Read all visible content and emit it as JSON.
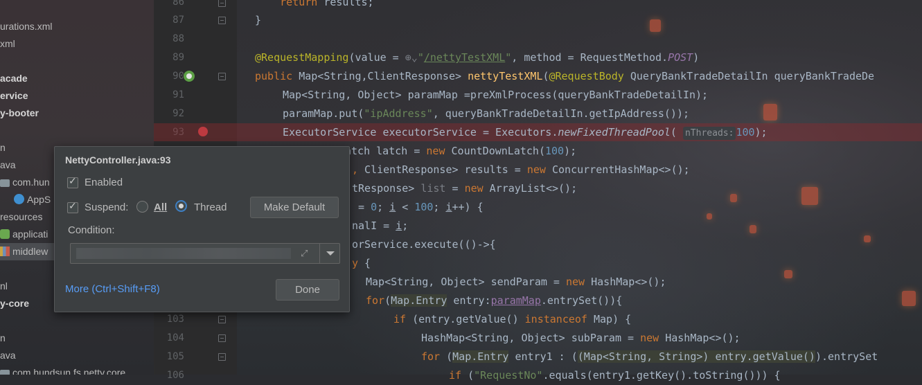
{
  "project_tree": {
    "items": [
      {
        "label": "urations.xml",
        "bold": false
      },
      {
        "label": "xml",
        "bold": false
      },
      {
        "label": "acade",
        "bold": true
      },
      {
        "label": "ervice",
        "bold": true
      },
      {
        "label": "y-booter",
        "bold": true
      },
      {
        "label": "n",
        "bold": false
      },
      {
        "label": "ava",
        "bold": false
      },
      {
        "label": "com.hun",
        "bold": false
      },
      {
        "label": "AppS",
        "bold": false
      },
      {
        "label": "resources",
        "bold": false
      },
      {
        "label": "applicati",
        "bold": false
      },
      {
        "label": "middlew",
        "bold": false
      },
      {
        "label": "nl",
        "bold": false
      },
      {
        "label": "y-core",
        "bold": true
      },
      {
        "label": "n",
        "bold": false
      },
      {
        "label": "ava",
        "bold": false
      },
      {
        "label": "com.hundsun.fs.netty.core",
        "bold": false
      }
    ]
  },
  "gutter": {
    "line_numbers": [
      "86",
      "87",
      "88",
      "89",
      "90",
      "91",
      "92",
      "93",
      "",
      "",
      "",
      "",
      "",
      "",
      "",
      "",
      "103",
      "104",
      "105",
      "106"
    ]
  },
  "editor": {
    "inlay_hint": "nThreads:"
  },
  "popup": {
    "title": "NettyController.java:93",
    "enabled_label": "Enabled",
    "suspend_label": "Suspend:",
    "all_label": "All",
    "thread_label": "Thread",
    "make_default_label": "Make Default",
    "condition_label": "Condition:",
    "more_label": "More (Ctrl+Shift+F8)",
    "done_label": "Done"
  },
  "colors": {
    "keyword": "#cc7832",
    "annotation": "#bbb529",
    "string": "#6a8759",
    "number": "#6897bb",
    "method": "#ffc66d",
    "breakpoint": "#e0474f",
    "link": "#589df6"
  }
}
